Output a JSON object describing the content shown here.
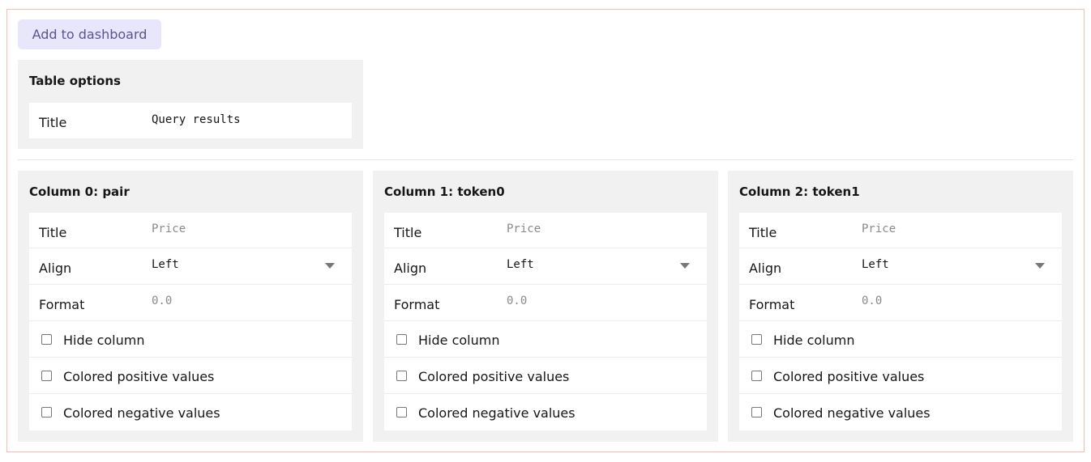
{
  "add_button": "Add to dashboard",
  "table_options": {
    "heading": "Table options",
    "title_label": "Title",
    "title_value": "Query results"
  },
  "columns": [
    {
      "heading": "Column 0: pair",
      "title_label": "Title",
      "title_placeholder": "Price",
      "align_label": "Align",
      "align_value": "Left",
      "format_label": "Format",
      "format_placeholder": "0.0",
      "hide": "Hide column",
      "pos": "Colored positive values",
      "neg": "Colored negative values"
    },
    {
      "heading": "Column 1: token0",
      "title_label": "Title",
      "title_placeholder": "Price",
      "align_label": "Align",
      "align_value": "Left",
      "format_label": "Format",
      "format_placeholder": "0.0",
      "hide": "Hide column",
      "pos": "Colored positive values",
      "neg": "Colored negative values"
    },
    {
      "heading": "Column 2: token1",
      "title_label": "Title",
      "title_placeholder": "Price",
      "align_label": "Align",
      "align_value": "Left",
      "format_label": "Format",
      "format_placeholder": "0.0",
      "hide": "Hide column",
      "pos": "Colored positive values",
      "neg": "Colored negative values"
    }
  ]
}
